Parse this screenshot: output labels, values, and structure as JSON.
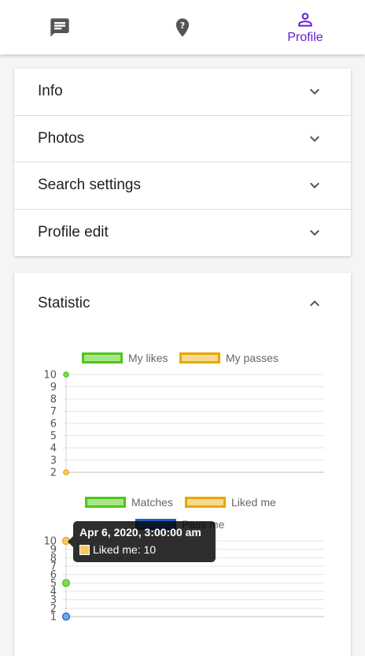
{
  "nav": {
    "items": [
      {
        "icon": "chat-icon"
      },
      {
        "icon": "location-help-icon"
      },
      {
        "icon": "person-icon",
        "label": "Profile"
      }
    ],
    "active_color": "#6a1bd6",
    "inactive_color": "#555555"
  },
  "panels": [
    {
      "title": "Info",
      "state": "collapsed"
    },
    {
      "title": "Photos",
      "state": "collapsed"
    },
    {
      "title": "Search settings",
      "state": "collapsed"
    },
    {
      "title": "Profile edit",
      "state": "collapsed"
    }
  ],
  "statistic": {
    "title": "Statistic",
    "state": "expanded"
  },
  "chart_data": [
    {
      "type": "scatter",
      "series": [
        {
          "name": "My likes",
          "color": "#7ed957",
          "border": "#52c41a",
          "y": [
            10
          ]
        },
        {
          "name": "My passes",
          "color": "#f5c96a",
          "border": "#e6a700",
          "y": [
            2
          ]
        }
      ],
      "yticks": [
        "2",
        "3",
        "4",
        "5",
        "6",
        "7",
        "8",
        "9",
        "10"
      ],
      "ylim": [
        2,
        10
      ],
      "legend": "top"
    },
    {
      "type": "scatter",
      "series": [
        {
          "name": "Matches",
          "color": "#7ed957",
          "border": "#52c41a",
          "y": [
            5
          ]
        },
        {
          "name": "Liked me",
          "color": "#f5c96a",
          "border": "#e6a700",
          "y": [
            10
          ]
        },
        {
          "name": "Pass me",
          "color": "#6fa8f0",
          "border": "#1f5fbf",
          "y": [
            1
          ]
        }
      ],
      "yticks": [
        "1",
        "2",
        "3",
        "4",
        "5",
        "6",
        "7",
        "8",
        "9",
        "10"
      ],
      "ylim": [
        1,
        10
      ],
      "legend": "top"
    }
  ],
  "tooltip": {
    "title": "Apr 6, 2020, 3:00:00 am",
    "label": "Liked me: 10"
  }
}
